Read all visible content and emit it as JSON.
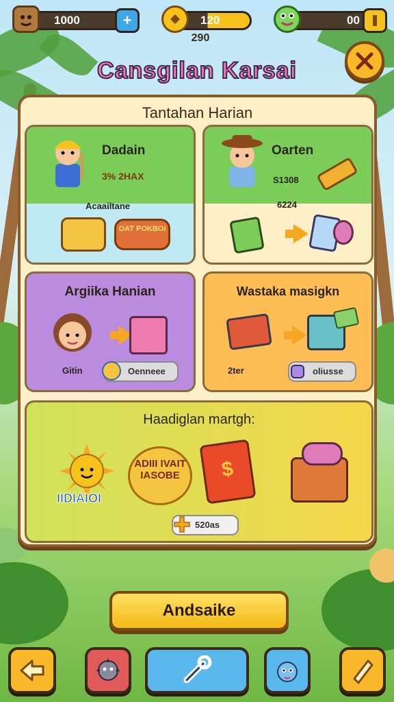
{
  "topbar": {
    "resource1": {
      "value": "1000",
      "add_icon": "plus-icon",
      "icon": "wood-crate-icon"
    },
    "resource2": {
      "value": "120",
      "sub_value": "290",
      "icon": "gold-coin-icon"
    },
    "resource3": {
      "value": "00",
      "icon": "frog-icon",
      "button_icon": "pause-icon"
    }
  },
  "close_icon": "close-x-icon",
  "title": "Cansgilan Karsai",
  "board": {
    "title": "Tantahan Harian",
    "cards": [
      {
        "title": "Dadain",
        "stat": "3% 2HAX",
        "caption": "Acaailtane",
        "badge": "OAT POKBOI"
      },
      {
        "title": "Oarten",
        "stat": "S1308",
        "caption": "6224"
      },
      {
        "title": "Argiika Hanian",
        "caption": "Gitin",
        "pill": "Oenneee"
      },
      {
        "title": "Wastaka masigkn",
        "caption": "2ter",
        "pill": "oliusse"
      }
    ],
    "bottom": {
      "title": "Haadiglan martgh:",
      "sun_label": "IIDIAIOI",
      "badge_text": "ADIII IVAIT IASOBE",
      "pill": "520as"
    }
  },
  "action_button": "Andsaike",
  "nav": [
    "back-arrow-icon",
    "spiky-creature-icon",
    "wrench-icon",
    "blue-critter-icon",
    "pencil-icon"
  ],
  "colors": {
    "green_head": "#7ccc5a",
    "cyan_body": "#bfeaf4",
    "purple": "#b98ce0",
    "orange": "#ffbe55",
    "yellow": "#f2e04a"
  }
}
